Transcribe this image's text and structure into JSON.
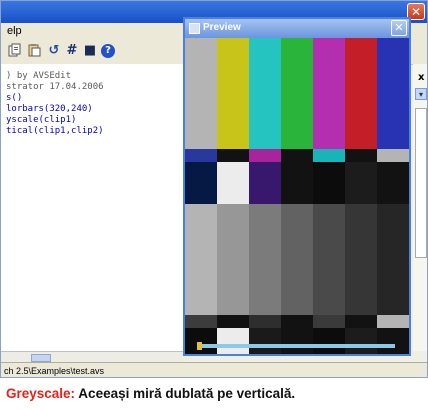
{
  "editor": {
    "menu_label": "elp",
    "toolbar_icons": [
      "copy-icon",
      "paste-icon",
      "undo-icon",
      "hash-icon",
      "save-icon",
      "help-icon"
    ],
    "toolbar_glyphs": [
      "",
      "",
      "↺",
      "#",
      "■",
      "?"
    ],
    "code_lines": [
      ") by AVSEdit",
      "strator 17.04.2006",
      "s()",
      "lorbars(320,240)",
      "yscale(clip1)",
      "tical(clip1,clip2)"
    ],
    "status_path": "ch 2.5\\Examples\\test.avs"
  },
  "preview": {
    "title": "Preview",
    "close_glyph": "✕"
  },
  "side_panel": {
    "close_glyph": "x",
    "dropdown_glyph": "▾"
  },
  "caption": {
    "label": "Greyscale:",
    "text": " Aceeași miră dublată pe verticală."
  },
  "colors": {
    "accent": "#e2231a",
    "titlebar": "#3a77e0",
    "preview_frame": "#4a80e0",
    "code_keyword": "#0000c8",
    "code_comment": "#5a5a5a",
    "colorbars_top": [
      "#b4b4b4",
      "#c8c41a",
      "#25c4c0",
      "#2bb43c",
      "#b42fb0",
      "#c41e28",
      "#2833b4"
    ],
    "colorbars_mid": [
      "#28389c",
      "#121212",
      "#a8249c",
      "#121212",
      "#18b4b8",
      "#121212",
      "#b4b4b4"
    ],
    "colorbars_low": [
      "#061944",
      "#ececec",
      "#38186c",
      "#121212",
      "#0c0c0c",
      "#1c1c1c",
      "#121212"
    ],
    "greyscale_top": [
      "#b4b4b4",
      "#979797",
      "#7b7b7b",
      "#626262",
      "#4a4a4a",
      "#363636",
      "#262626"
    ],
    "greyscale_mid": [
      "#3c3c3c",
      "#121212",
      "#2e2e2e",
      "#121212",
      "#3a3a3a",
      "#121212",
      "#b4b4b4"
    ],
    "greyscale_low": [
      "#0c0c0c",
      "#ececec",
      "#1a1a1a",
      "#121212",
      "#0c0c0c",
      "#1c1c1c",
      "#121212"
    ],
    "slider_bar": "#8cc8e8"
  }
}
